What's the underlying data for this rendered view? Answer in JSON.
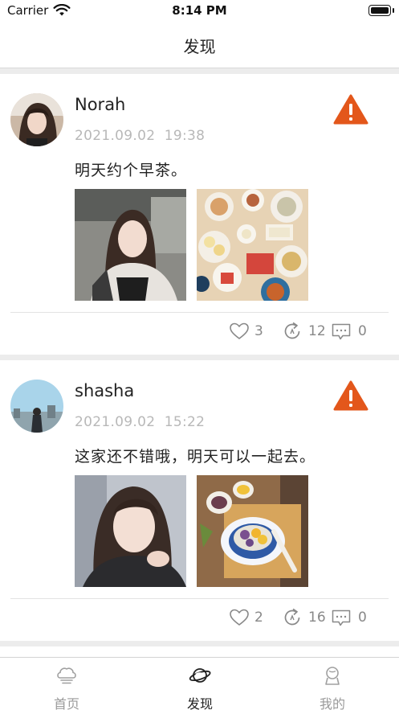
{
  "status_bar": {
    "carrier": "Carrier",
    "time": "8:14 PM"
  },
  "nav": {
    "title": "发现"
  },
  "posts": [
    {
      "username": "Norah",
      "date": "2021.09.02",
      "time": "19:38",
      "text": "明天约个早茶。",
      "likes": "3",
      "reposts": "12",
      "comments": "0"
    },
    {
      "username": "shasha",
      "date": "2021.09.02",
      "time": "15:22",
      "text": "这家还不错哦，明天可以一起去。",
      "likes": "2",
      "reposts": "16",
      "comments": "0"
    }
  ],
  "tabs": [
    {
      "label": "首页",
      "icon": "home-icon"
    },
    {
      "label": "发现",
      "icon": "planet-icon"
    },
    {
      "label": "我的",
      "icon": "profile-icon"
    }
  ],
  "colors": {
    "warning": "#e3571b",
    "separator": "#ececec",
    "muted_text": "#b8b8b8",
    "count_text": "#888888"
  }
}
